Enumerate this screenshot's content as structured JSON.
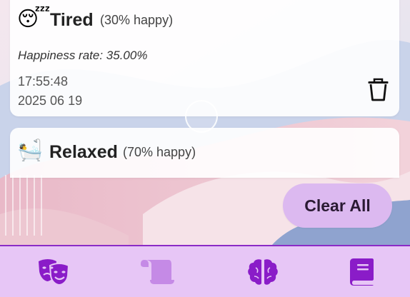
{
  "entries": [
    {
      "emoji": "😴",
      "mood": "Tired",
      "happy_text": "(30% happy)",
      "rate_text": "Happiness rate: 35.00%",
      "time": "17:55:48",
      "date": "2025 06 19"
    },
    {
      "emoji": "🛀",
      "mood": "Relaxed",
      "happy_text": "(70% happy)"
    }
  ],
  "clear_all_label": "Clear All",
  "nav": [
    {
      "icon": "theater-masks-icon",
      "active": true
    },
    {
      "icon": "scroll-icon",
      "active": false
    },
    {
      "icon": "brain-icon",
      "active": true
    },
    {
      "icon": "book-icon",
      "active": true
    }
  ],
  "colors": {
    "nav_background": "#e7c6f6",
    "nav_border": "#8b2bc6",
    "nav_icon": "#8a1cc8",
    "nav_icon_inactive": "#c58ae6",
    "clear_button": "#dcb9f0"
  }
}
